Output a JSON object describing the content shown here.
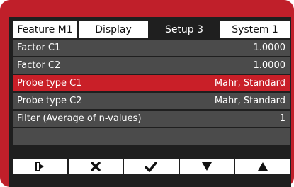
{
  "tabs": [
    {
      "label": "Feature  M1",
      "active": false
    },
    {
      "label": "Display",
      "active": false
    },
    {
      "label": "Setup 3",
      "active": true
    },
    {
      "label": "System 1",
      "active": false
    }
  ],
  "rows": [
    {
      "label": "Factor C1",
      "value": "1.0000",
      "selected": false
    },
    {
      "label": "Factor C2",
      "value": "1.0000",
      "selected": false
    },
    {
      "label": "Probe type C1",
      "value": "Mahr, Standard",
      "selected": true
    },
    {
      "label": "Probe type C2",
      "value": "Mahr, Standard",
      "selected": false
    },
    {
      "label": "Filter (Average of n-values)",
      "value": "1",
      "selected": false
    }
  ],
  "toolbar": {
    "buttons": [
      {
        "icon": "exit-icon"
      },
      {
        "icon": "cancel-icon"
      },
      {
        "icon": "confirm-icon"
      },
      {
        "icon": "arrow-down-icon"
      },
      {
        "icon": "arrow-up-icon"
      }
    ]
  },
  "colors": {
    "frame": "#c01f2a",
    "screen": "#1f1f1f",
    "row": "#4b4b4b",
    "selected_row": "#c91f28"
  }
}
